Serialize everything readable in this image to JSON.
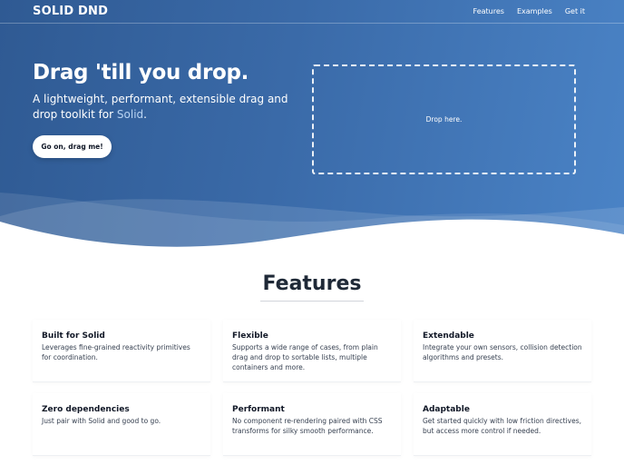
{
  "nav": {
    "brand": "SOLID DND",
    "links": [
      "Features",
      "Examples",
      "Get it"
    ]
  },
  "hero": {
    "headline": "Drag 'till you drop.",
    "tagline_prefix": "A lightweight, performant, extensible drag and drop toolkit for ",
    "tagline_highlight": "Solid",
    "tagline_suffix": ".",
    "cta_label": "Go on, drag me!",
    "dropzone_label": "Drop here."
  },
  "features": {
    "title": "Features",
    "items": [
      {
        "title": "Built for Solid",
        "desc": "Leverages fine-grained reactivity primitives for coordination."
      },
      {
        "title": "Flexible",
        "desc": "Supports a wide range of cases, from plain drag and drop to sortable lists, multiple containers and more."
      },
      {
        "title": "Extendable",
        "desc": "Integrate your own sensors, collision detection algorithms and presets."
      },
      {
        "title": "Zero dependencies",
        "desc": "Just pair with Solid and good to go."
      },
      {
        "title": "Performant",
        "desc": "No component re-rendering paired with CSS transforms for silky smooth performance."
      },
      {
        "title": "Adaptable",
        "desc": "Get started quickly with low friction directives, but access more control if needed."
      }
    ]
  },
  "colors": {
    "hero_start": "#2f5a93",
    "hero_end": "#4a83c6",
    "accent_text": "#b9d4f3"
  }
}
